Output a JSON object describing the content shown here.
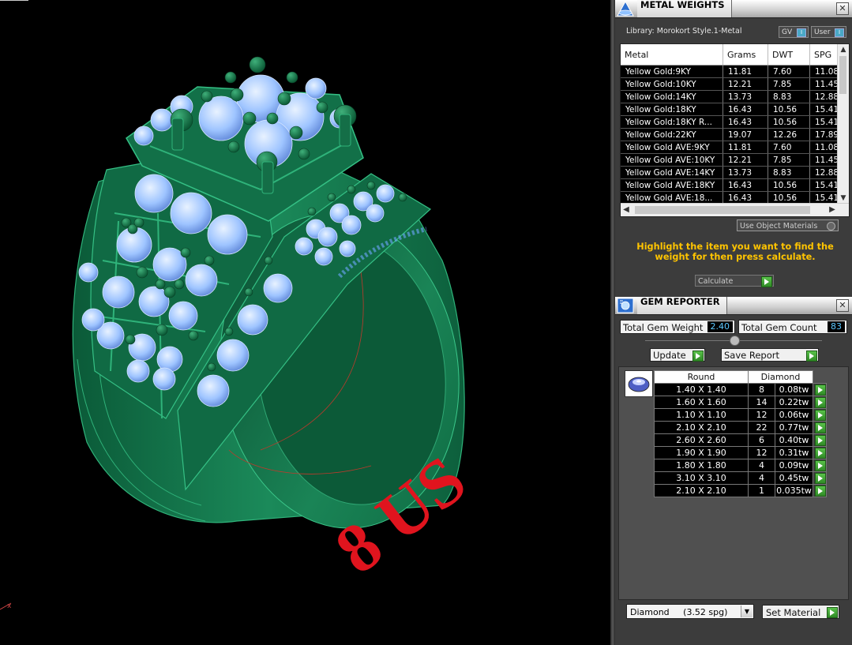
{
  "viewport": {
    "size_label": "8 US"
  },
  "metal_weights": {
    "title": "METAL WEIGHTS",
    "library": "Library: Morokort Style.1-Metal",
    "gv_label": "GV",
    "user_label": "User",
    "toggle_glyph": "I",
    "close_glyph": "✕",
    "columns": [
      "Metal",
      "Grams",
      "DWT",
      "SPG"
    ],
    "rows": [
      [
        "Yellow Gold:9KY",
        "11.81",
        "7.60",
        "11.08"
      ],
      [
        "Yellow Gold:10KY",
        "12.21",
        "7.85",
        "11.45"
      ],
      [
        "Yellow Gold:14KY",
        "13.73",
        "8.83",
        "12.88"
      ],
      [
        "Yellow Gold:18KY",
        "16.43",
        "10.56",
        "15.41"
      ],
      [
        "Yellow Gold:18KY R...",
        "16.43",
        "10.56",
        "15.41"
      ],
      [
        "Yellow Gold:22KY",
        "19.07",
        "12.26",
        "17.89"
      ],
      [
        "Yellow Gold AVE:9KY",
        "11.81",
        "7.60",
        "11.08"
      ],
      [
        "Yellow Gold AVE:10KY",
        "12.21",
        "7.85",
        "11.45"
      ],
      [
        "Yellow Gold AVE:14KY",
        "13.73",
        "8.83",
        "12.88"
      ],
      [
        "Yellow Gold AVE:18KY",
        "16.43",
        "10.56",
        "15.41"
      ],
      [
        "Yellow Gold AVE:18...",
        "16.43",
        "10.56",
        "15.41"
      ]
    ],
    "use_object_materials": "Use Object Materials",
    "hint": "Highlight the item you want to find the weight for then press calculate.",
    "calculate_label": "Calculate"
  },
  "gem_reporter": {
    "title": "GEM REPORTER",
    "total_weight_label": "Total Gem Weight",
    "total_weight_value": "2.40",
    "total_count_label": "Total Gem Count",
    "total_count_value": "83",
    "update_label": "Update",
    "save_report_label": "Save Report",
    "shape_header": "Round",
    "type_header": "Diamond",
    "gems": [
      {
        "size": "1.40 X 1.40",
        "count": "8",
        "weight": "0.08tw"
      },
      {
        "size": "1.60 X 1.60",
        "count": "14",
        "weight": "0.22tw"
      },
      {
        "size": "1.10 X 1.10",
        "count": "12",
        "weight": "0.06tw"
      },
      {
        "size": "2.10 X 2.10",
        "count": "22",
        "weight": "0.77tw"
      },
      {
        "size": "2.60 X 2.60",
        "count": "6",
        "weight": "0.40tw"
      },
      {
        "size": "1.90 X 1.90",
        "count": "12",
        "weight": "0.31tw"
      },
      {
        "size": "1.80 X 1.80",
        "count": "4",
        "weight": "0.09tw"
      },
      {
        "size": "3.10 X 3.10",
        "count": "4",
        "weight": "0.45tw"
      },
      {
        "size": "2.10 X 2.10",
        "count": "1",
        "weight": "0.035tw"
      }
    ],
    "material_select": "Diamond     (3.52 spg)",
    "set_material_label": "Set Material"
  },
  "colors": {
    "ring_green": "#14704a",
    "gem_blue": "#9ec8ff",
    "label_red": "#e0141e",
    "hint_yellow": "#ffc400"
  }
}
